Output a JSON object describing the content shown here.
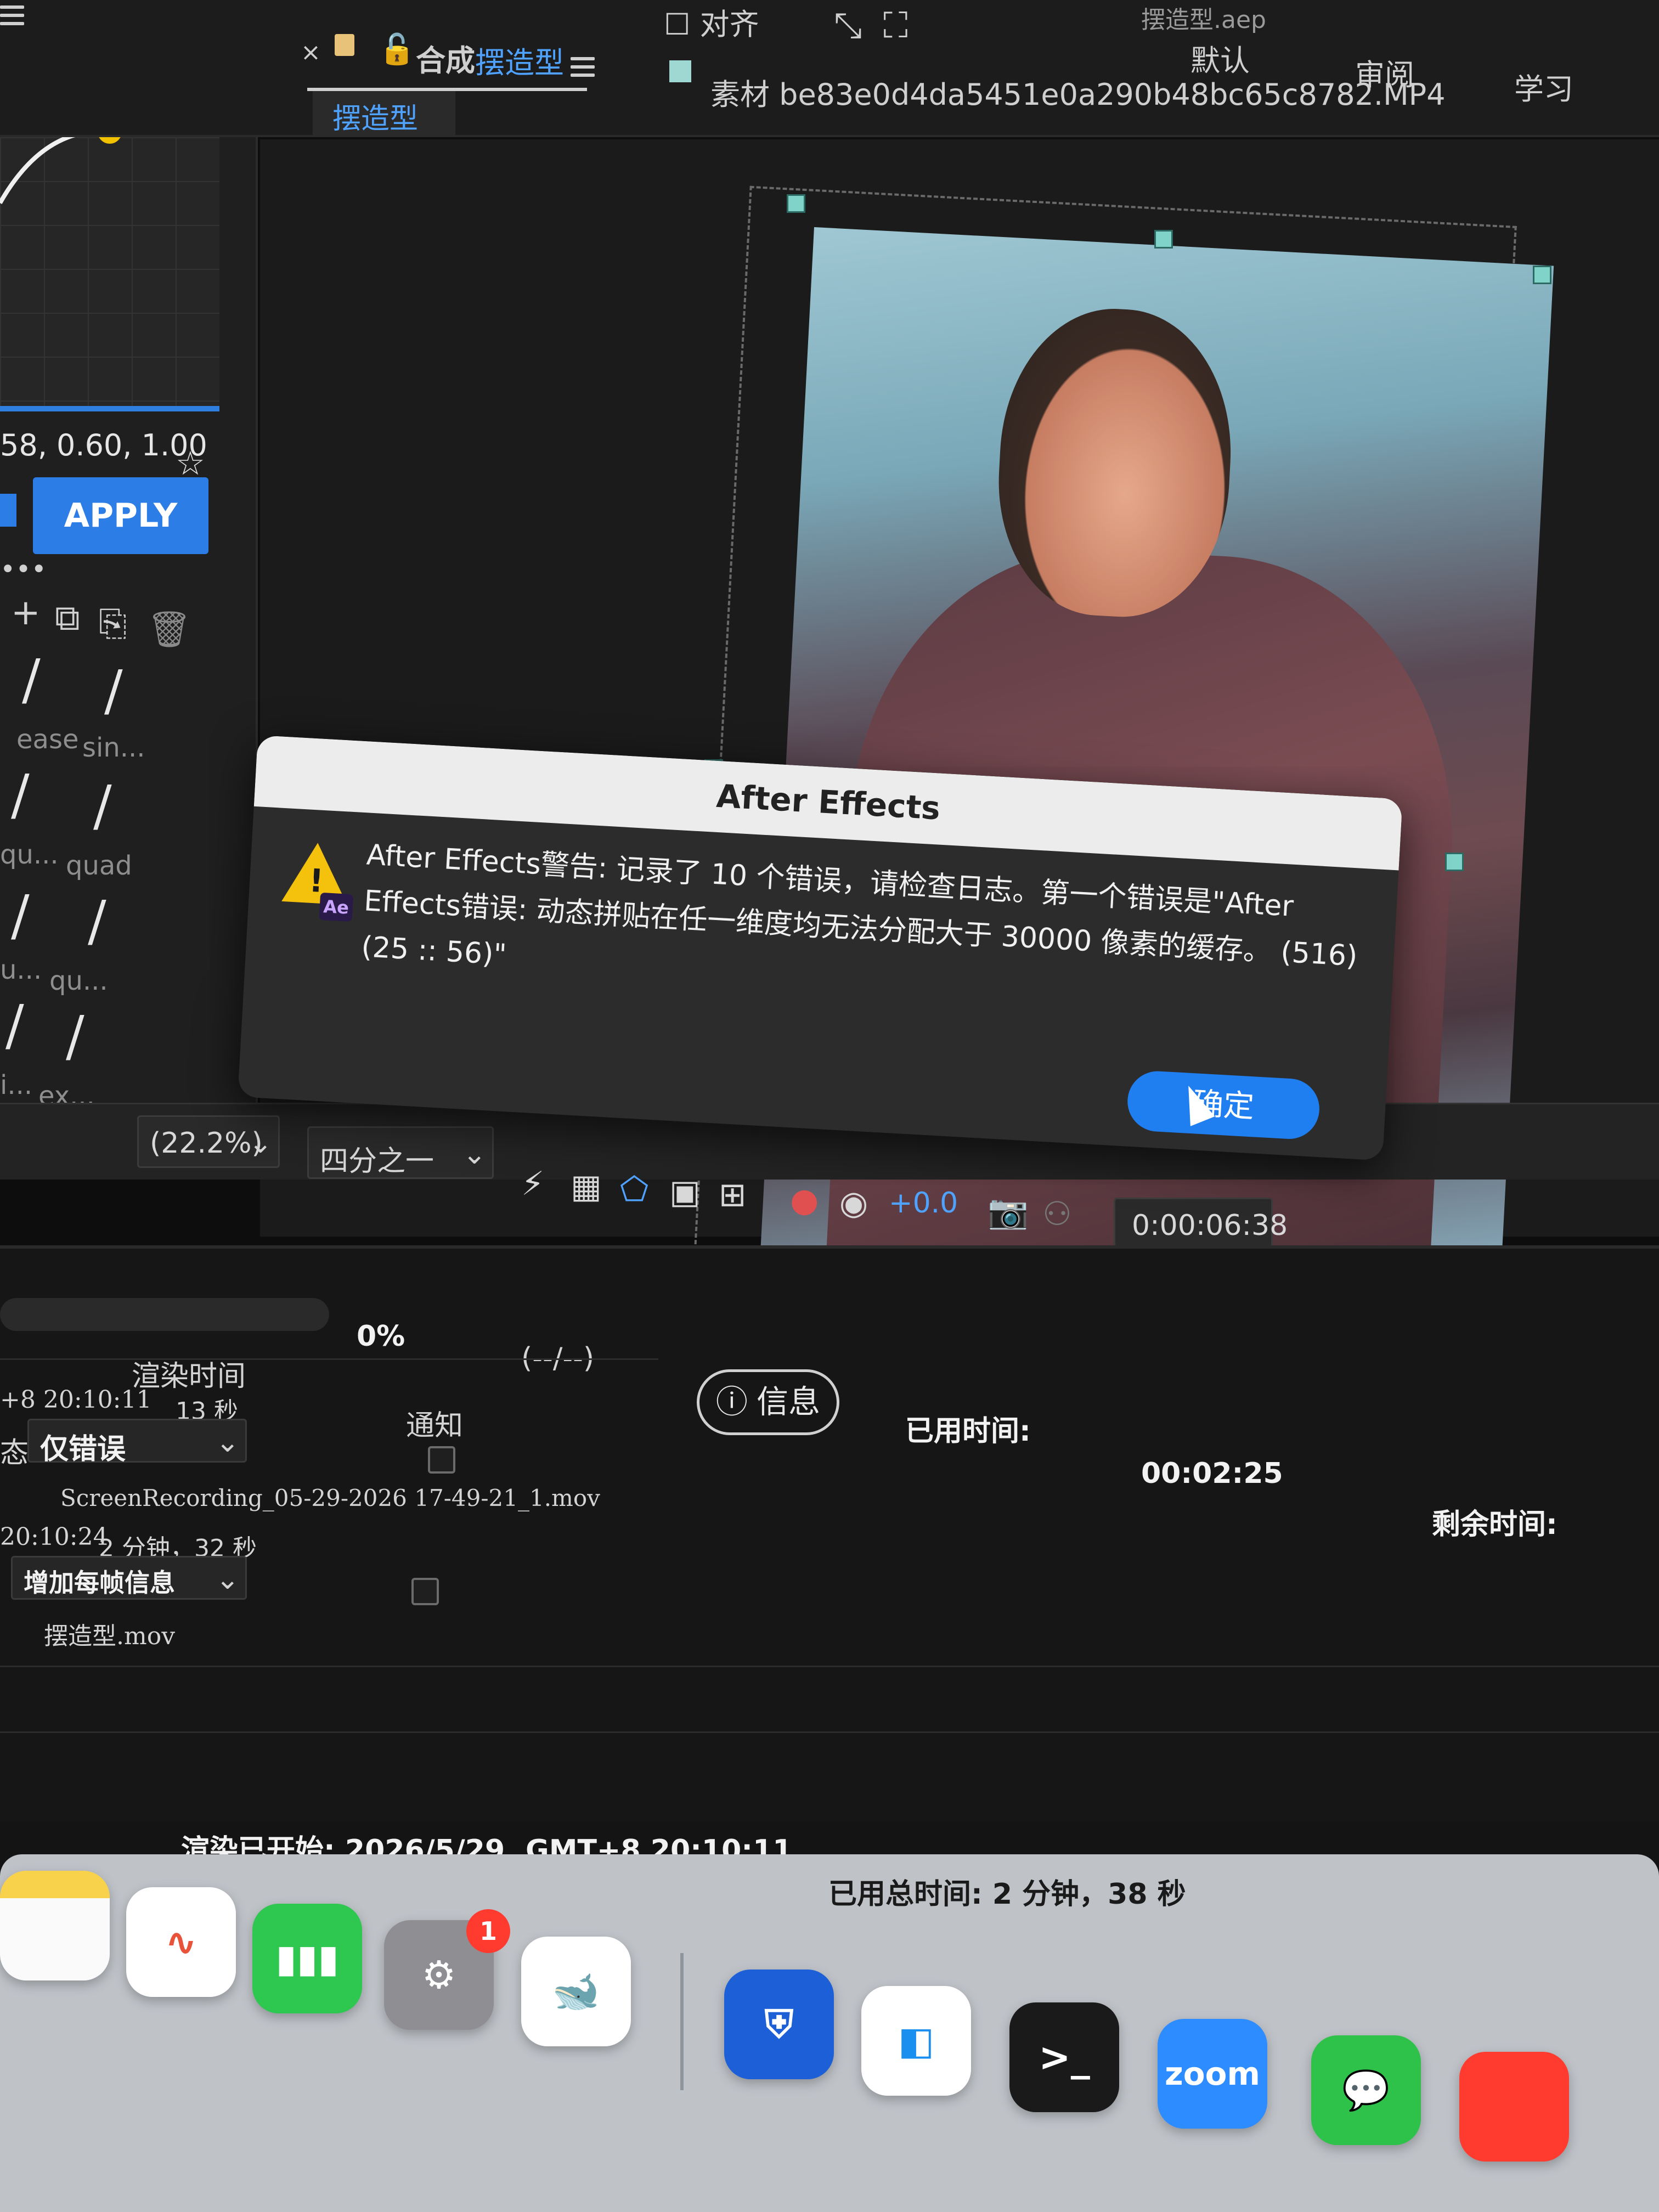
{
  "header": {
    "close_label": "×",
    "comp_prefix": "合成",
    "comp_name": "摆造型",
    "comp_tab": "摆造型",
    "align_label": "对齐",
    "footage_label": "素材 be83e0d4da5451e0a290b48bc65c8782.MP4",
    "project_file": "摆造型.aep",
    "workspace": [
      "默认",
      "审阅",
      "学习"
    ]
  },
  "easing_panel": {
    "bezier_values": "58, 0.60, 1.00",
    "apply_label": "APPLY",
    "presets": [
      {
        "glyph": "/",
        "label": "ease"
      },
      {
        "glyph": "/",
        "label": "sin..."
      },
      {
        "glyph": "/",
        "label": "qu..."
      },
      {
        "glyph": "/",
        "label": "quad"
      },
      {
        "glyph": "/",
        "label": "u..."
      },
      {
        "glyph": "/",
        "label": "qu..."
      },
      {
        "glyph": "/",
        "label": "i..."
      },
      {
        "glyph": "/",
        "label": "ex..."
      }
    ],
    "tools": [
      "+",
      "⧉",
      "⎘",
      "🗑"
    ]
  },
  "viewer_toolbar": {
    "zoom": "(22.2%)",
    "resolution": "四分之一",
    "exposure": "+0.0",
    "timecode": "0:00:06:38"
  },
  "dialog": {
    "title": "After Effects",
    "badge": "Ae",
    "message": "After Effects警告: 记录了 10 个错误，请检查日志。第一个错误是\"After Effects错误: 动态拼贴在任一维度均无法分配大于 30000 像素的缓存。 (516) (25 :: 56)\"",
    "ok_label": "确定"
  },
  "render_queue": {
    "progress_percent": "0%",
    "progress_value": 0,
    "eta_placeholder": "(--/--)",
    "info_label": "信息",
    "elapsed_label": "已用时间:",
    "elapsed_value": "00:02:25",
    "remaining_label": "剩余时间:",
    "col_render_time": "渲染时间",
    "col_notify": "通知",
    "item1_time": "+8 20:10:11",
    "item1_duration": "13 秒",
    "item1_status_label": "态:",
    "item1_status_value": "仅错误",
    "item1_output": "ScreenRecording_05-29-2026 17-49-21_1.mov",
    "item2_time": "20:10:24",
    "item2_duration": "2 分钟，32 秒",
    "item2_log": "增加每帧信息",
    "item2_output": "摆造型.mov"
  },
  "status": {
    "render_started": "渲染已开始: 2026/5/29, GMT+8 20:10:11",
    "total_elapsed": "已用总时间: 2 分钟，38 秒"
  },
  "dock": {
    "badge_count": "1",
    "zoom_label": "zoom",
    "terminal_label": ">_"
  }
}
